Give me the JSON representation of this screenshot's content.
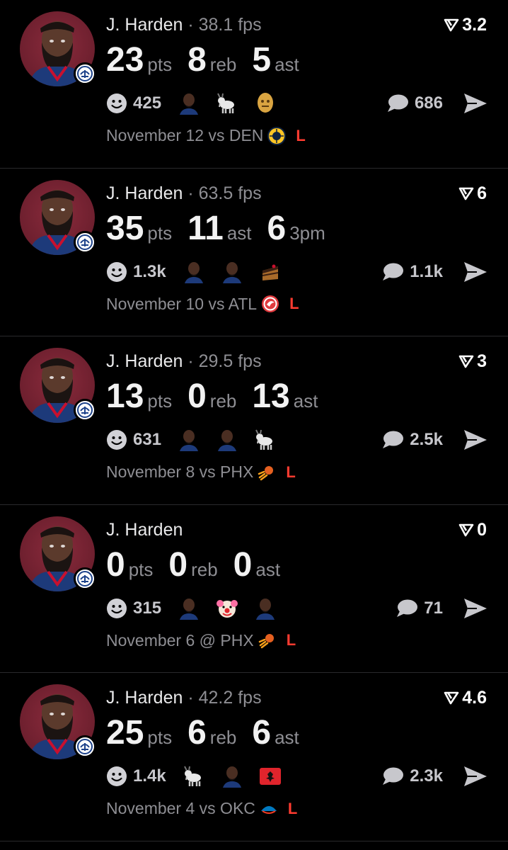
{
  "colors": {
    "background": "#000000",
    "loss": "#ff3b30",
    "muted": "#8e8e93",
    "divider": "#2a2a2c"
  },
  "posts": [
    {
      "name": "J. Harden",
      "separator": "·",
      "fps": "38.1 fps",
      "rating": "3.2",
      "stats": [
        {
          "value": "23",
          "label": "pts"
        },
        {
          "value": "8",
          "label": "reb"
        },
        {
          "value": "5",
          "label": "ast"
        }
      ],
      "reactions": "425",
      "reaction_icons": [
        "player-face-icon",
        "goat-icon",
        "trophy-face-icon"
      ],
      "comments": "686",
      "game": "November 12 vs DEN",
      "opponent_icon": "nuggets-logo-icon",
      "result": "L"
    },
    {
      "name": "J. Harden",
      "separator": "·",
      "fps": "63.5 fps",
      "rating": "6",
      "stats": [
        {
          "value": "35",
          "label": "pts"
        },
        {
          "value": "11",
          "label": "ast"
        },
        {
          "value": "6",
          "label": "3pm"
        }
      ],
      "reactions": "1.3k",
      "reaction_icons": [
        "player-face-icon",
        "player-face-icon",
        "cake-icon"
      ],
      "comments": "1.1k",
      "game": "November 10 vs ATL",
      "opponent_icon": "hawks-logo-icon",
      "result": "L"
    },
    {
      "name": "J. Harden",
      "separator": "·",
      "fps": "29.5 fps",
      "rating": "3",
      "stats": [
        {
          "value": "13",
          "label": "pts"
        },
        {
          "value": "0",
          "label": "reb"
        },
        {
          "value": "13",
          "label": "ast"
        }
      ],
      "reactions": "631",
      "reaction_icons": [
        "player-face-icon",
        "player-face-icon",
        "goat-icon"
      ],
      "comments": "2.5k",
      "game": "November 8 vs PHX",
      "opponent_icon": "suns-logo-icon",
      "result": "L"
    },
    {
      "name": "J. Harden",
      "separator": "",
      "fps": "",
      "rating": "0",
      "stats": [
        {
          "value": "0",
          "label": "pts"
        },
        {
          "value": "0",
          "label": "reb"
        },
        {
          "value": "0",
          "label": "ast"
        }
      ],
      "reactions": "315",
      "reaction_icons": [
        "player-face-icon",
        "clown-icon",
        "player-face-icon"
      ],
      "comments": "71",
      "game": "November 6 @ PHX",
      "opponent_icon": "suns-logo-icon",
      "result": "L"
    },
    {
      "name": "J. Harden",
      "separator": "·",
      "fps": "42.2 fps",
      "rating": "4.6",
      "stats": [
        {
          "value": "25",
          "label": "pts"
        },
        {
          "value": "6",
          "label": "reb"
        },
        {
          "value": "6",
          "label": "ast"
        }
      ],
      "reactions": "1.4k",
      "reaction_icons": [
        "goat-icon",
        "player-face-icon",
        "albania-flag-icon"
      ],
      "comments": "2.3k",
      "game": "November 4 vs OKC",
      "opponent_icon": "thunder-logo-icon",
      "result": "L"
    }
  ]
}
